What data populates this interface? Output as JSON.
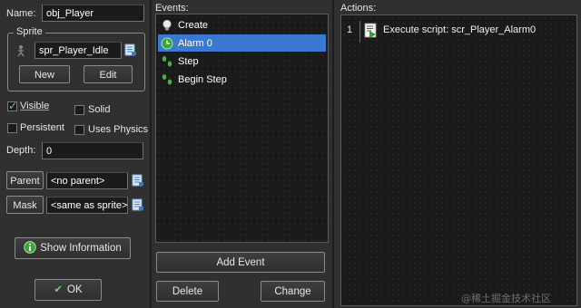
{
  "general": {
    "name_label": "Name:",
    "name_value": "obj_Player",
    "sprite_group_label": "Sprite",
    "sprite_value": "spr_Player_Idle",
    "new_label": "New",
    "edit_label": "Edit",
    "visible_label": "Visible",
    "visible_checked": true,
    "solid_label": "Solid",
    "solid_checked": false,
    "persistent_label": "Persistent",
    "persistent_checked": false,
    "physics_label": "Uses Physics",
    "physics_checked": false,
    "depth_label": "Depth:",
    "depth_value": "0",
    "parent_button": "Parent",
    "parent_value": "<no parent>",
    "mask_button": "Mask",
    "mask_value": "<same as sprite>",
    "show_info_label": "Show Information",
    "ok_label": "OK"
  },
  "events": {
    "header": "Events:",
    "items": [
      {
        "label": "Create",
        "icon": "lightbulb-icon",
        "selected": false
      },
      {
        "label": "Alarm 0",
        "icon": "clock-icon",
        "selected": true
      },
      {
        "label": "Step",
        "icon": "footsteps-icon",
        "selected": false
      },
      {
        "label": "Begin Step",
        "icon": "footsteps-icon",
        "selected": false
      }
    ],
    "add_event_label": "Add Event",
    "delete_label": "Delete",
    "change_label": "Change"
  },
  "actions": {
    "header": "Actions:",
    "items": [
      {
        "index": "1",
        "label": "Execute script: scr_Player_Alarm0",
        "icon": "script-icon"
      }
    ]
  },
  "watermark": "@稀土掘金技术社区",
  "colors": {
    "selection": "#3a79cf",
    "background": "#2b2b2b",
    "list_background": "#1a1a1a",
    "check_green": "#6fd36f"
  }
}
